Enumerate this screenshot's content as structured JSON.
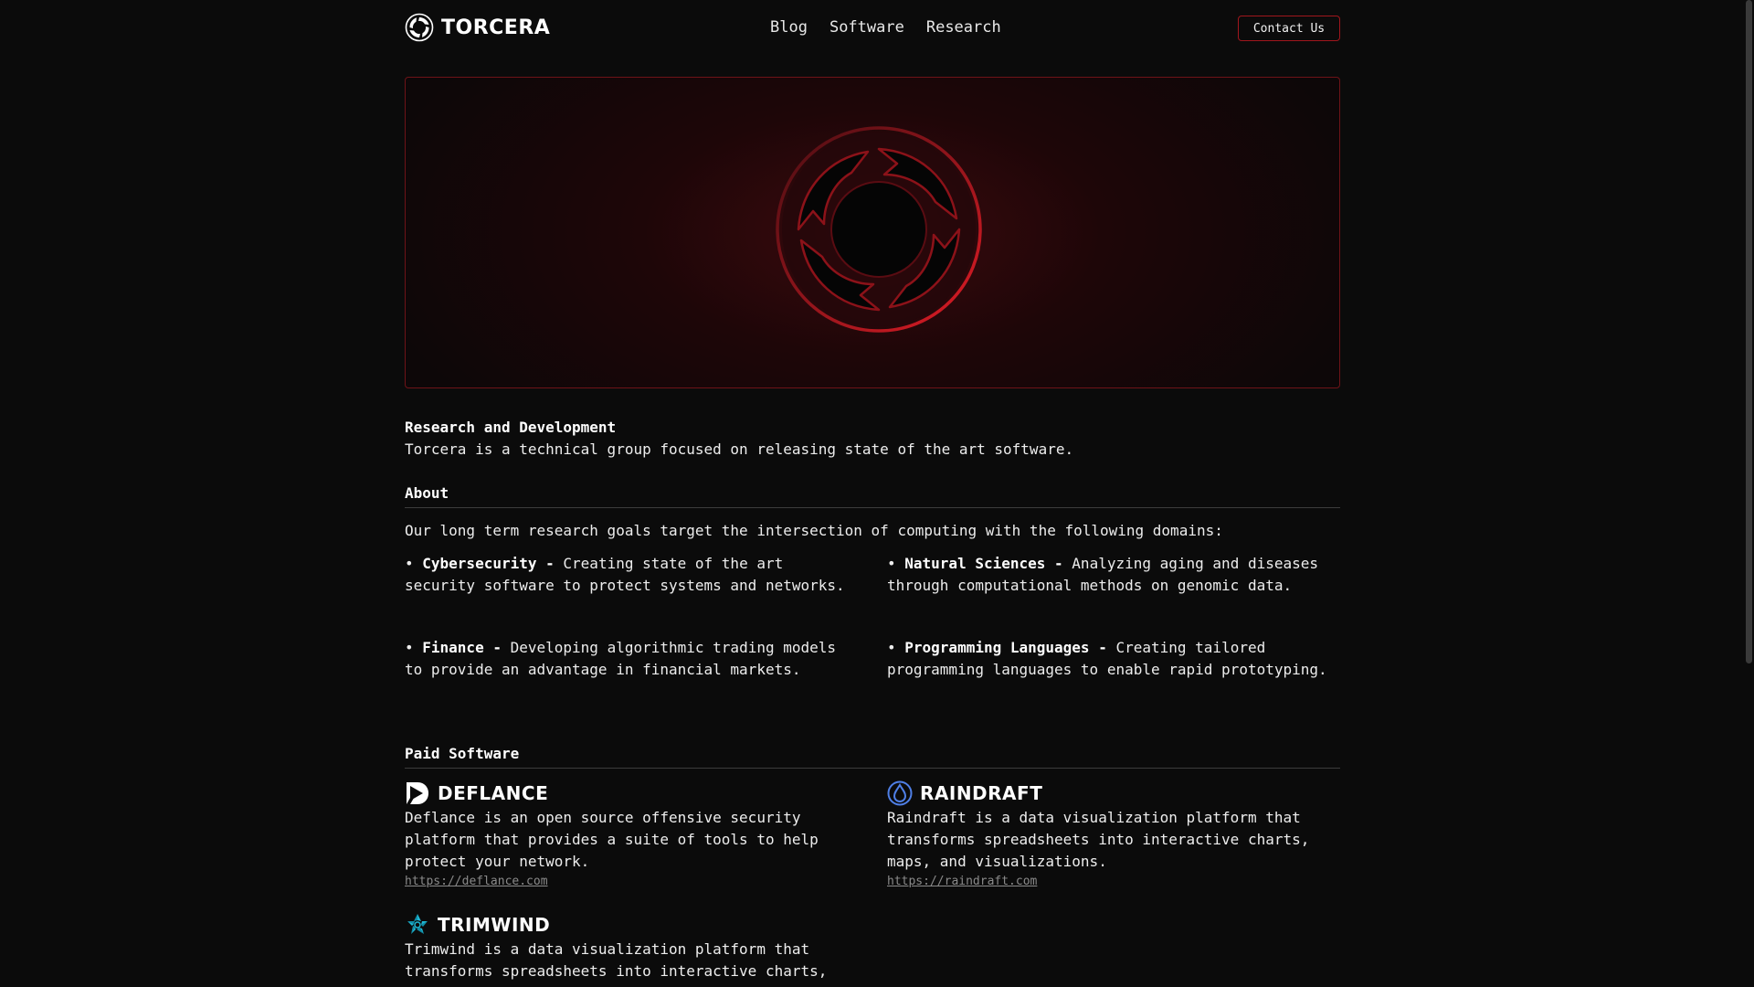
{
  "brand": {
    "name": "TORCERA",
    "logo_icon": "torcera-logo-icon"
  },
  "nav": {
    "items": [
      "Blog",
      "Software",
      "Research"
    ]
  },
  "header": {
    "contact_label": "Contact Us"
  },
  "colors": {
    "background": "#0b0b0b",
    "accent": "#a0161d",
    "link": "#8a8a8a"
  },
  "hero": {
    "emblem_icon": "torcera-emblem-icon"
  },
  "intro": {
    "heading": "Research and Development",
    "text": "Torcera is a technical group focused on releasing state of the art software."
  },
  "about": {
    "heading": "About",
    "lead": "Our long term research goals target the intersection of computing with the following domains:",
    "domains": [
      {
        "name": "Cybersecurity -",
        "text": "Creating state of the art security software to protect systems and networks."
      },
      {
        "name": "Natural Sciences -",
        "text": "Analyzing aging and diseases through computational methods on genomic data."
      },
      {
        "name": "Finance -",
        "text": "Developing algorithmic trading models to provide an advantage in financial markets."
      },
      {
        "name": "Programming Languages -",
        "text": "Creating tailored programming languages to enable rapid prototyping."
      }
    ]
  },
  "paid_software": {
    "heading": "Paid Software",
    "products": [
      {
        "name": "DEFLANCE",
        "icon": "deflance-logo-icon",
        "description": "Deflance is an open source offensive security platform that provides a suite of tools to help protect your network.",
        "link": "https://deflance.com"
      },
      {
        "name": "RAINDRAFT",
        "icon": "raindraft-logo-icon",
        "description": "Raindraft is a data visualization platform that transforms spreadsheets into interactive charts, maps, and visualizations.",
        "link": "https://raindraft.com"
      },
      {
        "name": "TRIMWIND",
        "icon": "trimwind-logo-icon",
        "description": "Trimwind is a data visualization platform that transforms spreadsheets into interactive charts,"
      }
    ]
  }
}
